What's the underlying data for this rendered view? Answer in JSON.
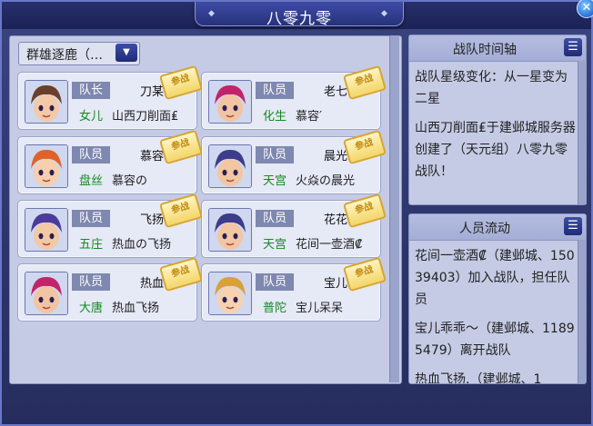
{
  "window": {
    "title": "八零九零",
    "close_symbol": "✕"
  },
  "dropdown": {
    "value": "群雄逐鹿（…",
    "arrow": "▼"
  },
  "stamp_text": "参战",
  "members": [
    {
      "role": "队长",
      "name": "刀某",
      "school": "女儿",
      "player": "山西刀削面₤",
      "hair": "#6b3f2a",
      "skin": "#f4c9a8",
      "school_color": "#148a22"
    },
    {
      "role": "队员",
      "name": "老七",
      "school": "化生",
      "player": "慕容′",
      "hair": "#c2246a",
      "skin": "#f2c4a3",
      "school_color": "#148a22"
    },
    {
      "role": "队员",
      "name": "慕容",
      "school": "盘丝",
      "player": "慕容の",
      "hair": "#e0622a",
      "skin": "#f6cfae",
      "school_color": "#148a22"
    },
    {
      "role": "队员",
      "name": "晨光",
      "school": "天宫",
      "player": "火焱の晨光",
      "hair": "#3c3c8a",
      "skin": "#f2c6a3",
      "school_color": "#148a22"
    },
    {
      "role": "队员",
      "name": "飞扬",
      "school": "五庄",
      "player": "热血の飞扬",
      "hair": "#4b3b9a",
      "skin": "#f3c8a4",
      "school_color": "#148a22"
    },
    {
      "role": "队员",
      "name": "花花",
      "school": "天宫",
      "player": "花间一壶酒₡",
      "hair": "#3c3c8a",
      "skin": "#f2c6a3",
      "school_color": "#148a22"
    },
    {
      "role": "队员",
      "name": "热血",
      "school": "大唐",
      "player": "热血飞扬",
      "hair": "#c2246a",
      "skin": "#f2c4a3",
      "school_color": "#148a22"
    },
    {
      "role": "队员",
      "name": "宝儿",
      "school": "普陀",
      "player": "宝儿呆呆",
      "hair": "#d9a13a",
      "skin": "#f6d2b2",
      "school_color": "#148a22"
    }
  ],
  "timeline": {
    "title": "战队时间轴",
    "menu_symbol": "☰",
    "entries": [
      "战队星级变化：从一星变为二星",
      "山西刀削面₤于建邺城服务器创建了（天元组）八零九零战队！"
    ]
  },
  "flow": {
    "title": "人员流动",
    "menu_symbol": "☰",
    "entries": [
      "花间一壶酒₡（建邺城、15039403）加入战队，担任队员",
      "宝儿乖乖～（建邺城、11895479）离开战队",
      "热血飞扬.（建邺城、1"
    ]
  }
}
